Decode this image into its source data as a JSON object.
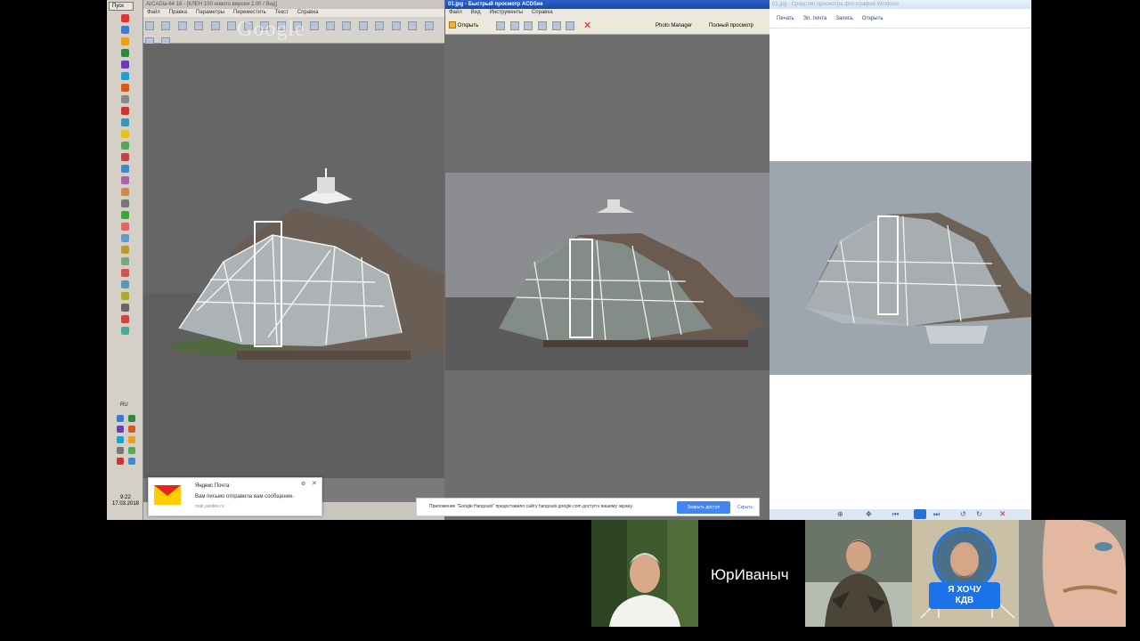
{
  "taskbar": {
    "start_label": "Пуск",
    "lang": "RU",
    "clock_time": "9:22",
    "clock_date": "17.03.2018",
    "icon_colors": [
      "#d33",
      "#3a7bd5",
      "#e8a21a",
      "#2a8a3a",
      "#6a3fb5",
      "#1aa1d5",
      "#d55a1a",
      "#888",
      "#c33",
      "#39b",
      "#e7c21a",
      "#5a5",
      "#b44",
      "#48c",
      "#a6a",
      "#c84",
      "#777",
      "#3a3",
      "#d66",
      "#69c",
      "#b93",
      "#7a7",
      "#c55",
      "#59b",
      "#aa3",
      "#666",
      "#c44",
      "#4a9"
    ]
  },
  "watermark": "Google",
  "windows": {
    "cad": {
      "title": "ArCADia-64 16 - [КЛЕН 100 нового версия 2.00 / Вид]",
      "menus": [
        "Файл",
        "Правка",
        "Параметры",
        "Переместить",
        "Текст",
        "Справка"
      ]
    },
    "acdsee": {
      "title": "01.jpg - Быстрый просмотр ACDSee",
      "menus": [
        "Файл",
        "Вид",
        "Инструменты",
        "Справка"
      ],
      "open_label": "Открыть",
      "photo_manager_label": "Photo Manager",
      "fullscreen_label": "Полный просмотр"
    },
    "photo_viewer": {
      "title": "01.jpg - Средство просмотра фотографий Windows",
      "commands": [
        "Печать",
        "Эл. почта",
        "Запись",
        "Открыть"
      ]
    }
  },
  "mail_toast": {
    "title": "Яндекс Почта",
    "body": "Вам письмо отправила вам сообщение.",
    "source": "mail.yandex.ru"
  },
  "share_bar": {
    "text": "Приложение \"Google Hangouts\" предоставило сайту hangouts.google.com доступ к вашему экрану.",
    "stop_label": "Закрыть доступ",
    "hide_label": "Скрыть"
  },
  "participants": {
    "main_name": "ЮрИваныч",
    "badge_text_line1": "Я ХОЧУ",
    "badge_text_line2": "КДВ"
  }
}
